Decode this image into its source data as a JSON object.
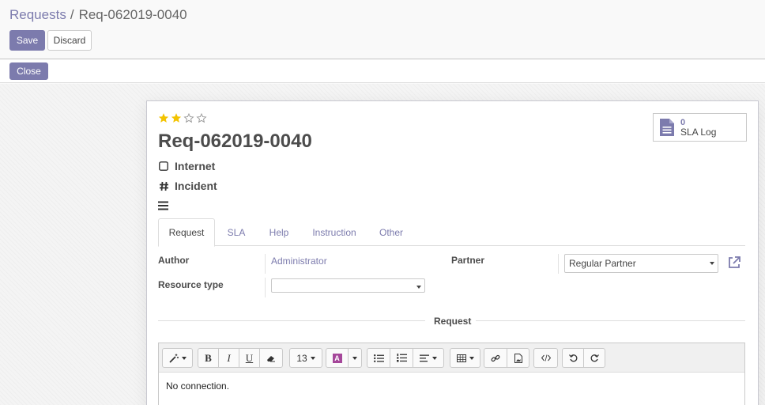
{
  "breadcrumb": {
    "parent": "Requests",
    "separator": "/",
    "current": "Req-062019-0040"
  },
  "buttons": {
    "save": "Save",
    "discard": "Discard",
    "close": "Close"
  },
  "priority": {
    "stars_total": 4,
    "stars_filled": 2,
    "star_color": "#f3c300"
  },
  "smart_button": {
    "count": "0",
    "label": "SLA Log",
    "icon": "file-icon"
  },
  "record": {
    "title": "Req-062019-0040",
    "category": {
      "icon": "checkbox-icon",
      "text": "Internet"
    },
    "type": {
      "icon": "hashtag-icon",
      "text": "Incident"
    },
    "stage_icon": "menu-icon"
  },
  "tabs": [
    {
      "label": "Request",
      "active": true
    },
    {
      "label": "SLA",
      "active": false
    },
    {
      "label": "Help",
      "active": false
    },
    {
      "label": "Instruction",
      "active": false
    },
    {
      "label": "Other",
      "active": false
    }
  ],
  "fields": {
    "author": {
      "label": "Author",
      "value": "Administrator"
    },
    "partner": {
      "label": "Partner",
      "value": "Regular Partner"
    },
    "resource_type": {
      "label": "Resource type",
      "value": ""
    }
  },
  "section_title": "Request",
  "editor": {
    "font_size": "13",
    "content": "No connection."
  },
  "colors": {
    "brand": "#7c7bad",
    "text": "#4c4c4c"
  }
}
